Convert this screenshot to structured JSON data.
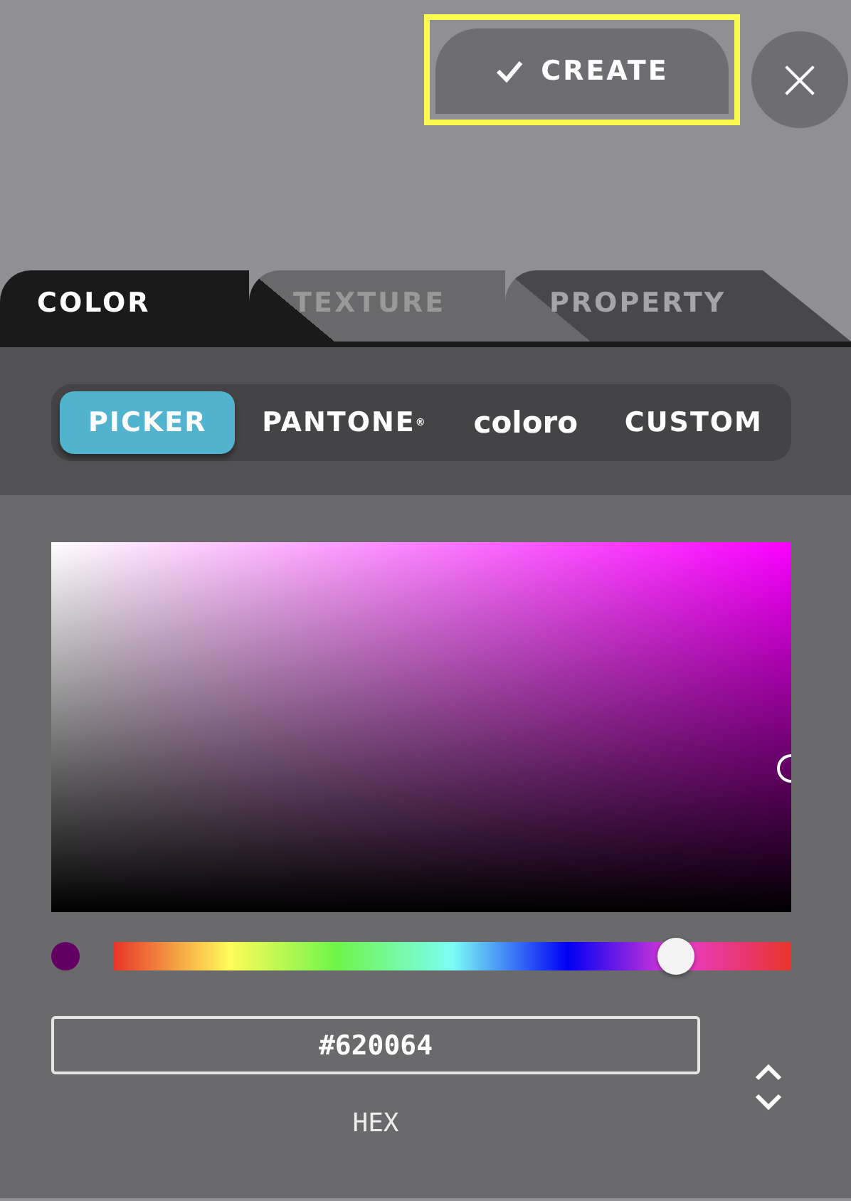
{
  "toolbar": {
    "create_button": {
      "label": "CREATE",
      "highlighted": true
    },
    "close_button": {
      "label": "×"
    }
  },
  "tabs": [
    {
      "label": "COLOR",
      "selected": true
    },
    {
      "label": "TEXTURE",
      "selected": false
    },
    {
      "label": "PROPERTY",
      "selected": false
    }
  ],
  "sources": [
    {
      "label": "PICKER",
      "selected": true
    },
    {
      "label": "PANTONE$^{®}$",
      "selected": false
    },
    {
      "label": "coloro",
      "selected": false
    },
    {
      "label": "CUSTOM",
      "selected": false
    }
  ],
  "picker": {
    "hue": {
      "level": 0.83
    },
    "swatch": {
      "color": "#620064"
    }
  },
  "hex_field": {
    "value": "#620064",
    "label": "HEX"
  }
}
